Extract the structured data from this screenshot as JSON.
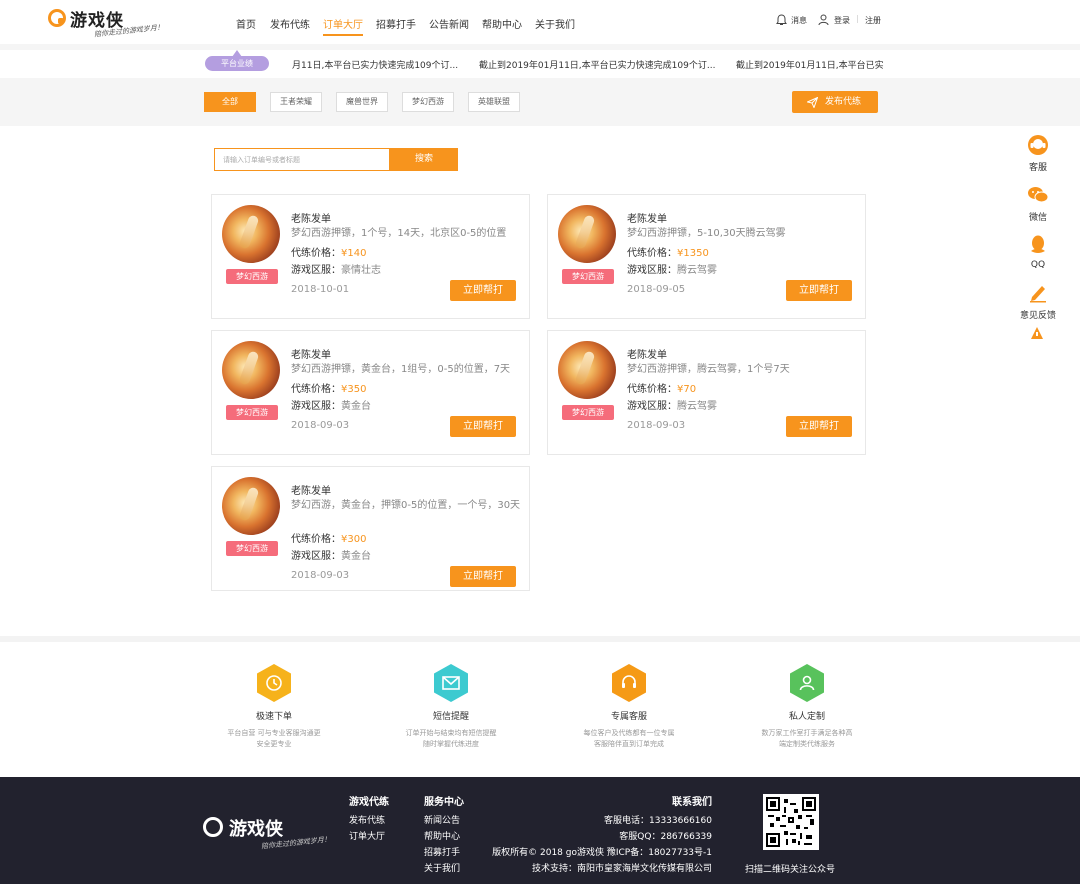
{
  "header": {
    "logo_text": "游戏侠",
    "logo_slogan": "陪你走过的游戏岁月！",
    "nav": [
      "首页",
      "发布代练",
      "订单大厅",
      "招募打手",
      "公告新闻",
      "帮助中心",
      "关于我们"
    ],
    "active_nav": "订单大厅",
    "messages": "消息",
    "login": "登录",
    "register": "注册",
    "accent": "#f7941d"
  },
  "ticker": {
    "badge": "平台业绩",
    "items": [
      "月11日,本平台已实力快速完成109个订...",
      "截止到2019年01月11日,本平台已实力快速完成109个订...",
      "截止到2019年01月11日,本平台已实"
    ]
  },
  "filters": {
    "chips": [
      "全部",
      "王者荣耀",
      "魔兽世界",
      "梦幻西游",
      "英雄联盟"
    ],
    "selected": "全部",
    "publish": "发布代练"
  },
  "search": {
    "placeholder": "请输入订单编号或者标题",
    "button": "搜索"
  },
  "orders": [
    {
      "author": "老陈发单",
      "tag": "梦幻西游",
      "desc": "梦幻西游押镖，1个号，14天，北京区0-5的位置",
      "price_label": "代练价格：",
      "price": "¥140",
      "server_label": "游戏区服：",
      "server": "豪情壮志",
      "date": "2018-10-01",
      "button": "立即帮打"
    },
    {
      "author": "老陈发单",
      "tag": "梦幻西游",
      "desc": "梦幻西游押镖，5-10,30天腾云驾雾",
      "price_label": "代练价格：",
      "price": "¥1350",
      "server_label": "游戏区服：",
      "server": "腾云驾雾",
      "date": "2018-09-05",
      "button": "立即帮打"
    },
    {
      "author": "老陈发单",
      "tag": "梦幻西游",
      "desc": "梦幻西游押镖，黄金台，1组号，0-5的位置，7天",
      "price_label": "代练价格：",
      "price": "¥350",
      "server_label": "游戏区服：",
      "server": "黄金台",
      "date": "2018-09-03",
      "button": "立即帮打"
    },
    {
      "author": "老陈发单",
      "tag": "梦幻西游",
      "desc": "梦幻西游押镖，腾云驾雾，1个号7天",
      "price_label": "代练价格：",
      "price": "¥70",
      "server_label": "游戏区服：",
      "server": "腾云驾雾",
      "date": "2018-09-03",
      "button": "立即帮打"
    },
    {
      "author": "老陈发单",
      "tag": "梦幻西游",
      "desc": "梦幻西游，黄金台，押镖0-5的位置，一个号，30天",
      "price_label": "代练价格：",
      "price": "¥300",
      "server_label": "游戏区服：",
      "server": "黄金台",
      "date": "2018-09-03",
      "button": "立即帮打"
    }
  ],
  "sidebar": {
    "items": [
      "客服",
      "微信",
      "QQ",
      "意见反馈"
    ]
  },
  "features": [
    {
      "title": "极速下单",
      "desc1": "平台自营 可与专业客服沟通更",
      "desc2": "安全更专业",
      "icon": "clock-icon",
      "color": "#f6b21b"
    },
    {
      "title": "短信提醒",
      "desc1": "订单开始与结束均有短信提醒",
      "desc2": "随时掌握代练进度",
      "icon": "mail-icon",
      "color": "#3ccad0"
    },
    {
      "title": "专属客服",
      "desc1": "每位客户及代练都有一位专属",
      "desc2": "客服陪伴直到订单完成",
      "icon": "headset-icon",
      "color": "#f59a16"
    },
    {
      "title": "私人定制",
      "desc1": "数万家工作室打手满足各种高",
      "desc2": "端定制类代练服务",
      "icon": "user-icon",
      "color": "#58c25c"
    }
  ],
  "footer": {
    "col1_title": "游戏代练",
    "col1_links": [
      "发布代练",
      "订单大厅"
    ],
    "col2_title": "服务中心",
    "col2_links": [
      "新闻公告",
      "帮助中心",
      "招募打手",
      "关于我们"
    ],
    "contact_title": "联系我们",
    "phone": "客服电话：13333666160",
    "qq": "客服QQ：286766339",
    "copyright": "版权所有© 2018 go游戏侠 豫ICP备：18027733号-1",
    "support": "技术支持：南阳市皇家海岸文化传媒有限公司",
    "qr_caption": "扫描二维码关注公众号"
  }
}
